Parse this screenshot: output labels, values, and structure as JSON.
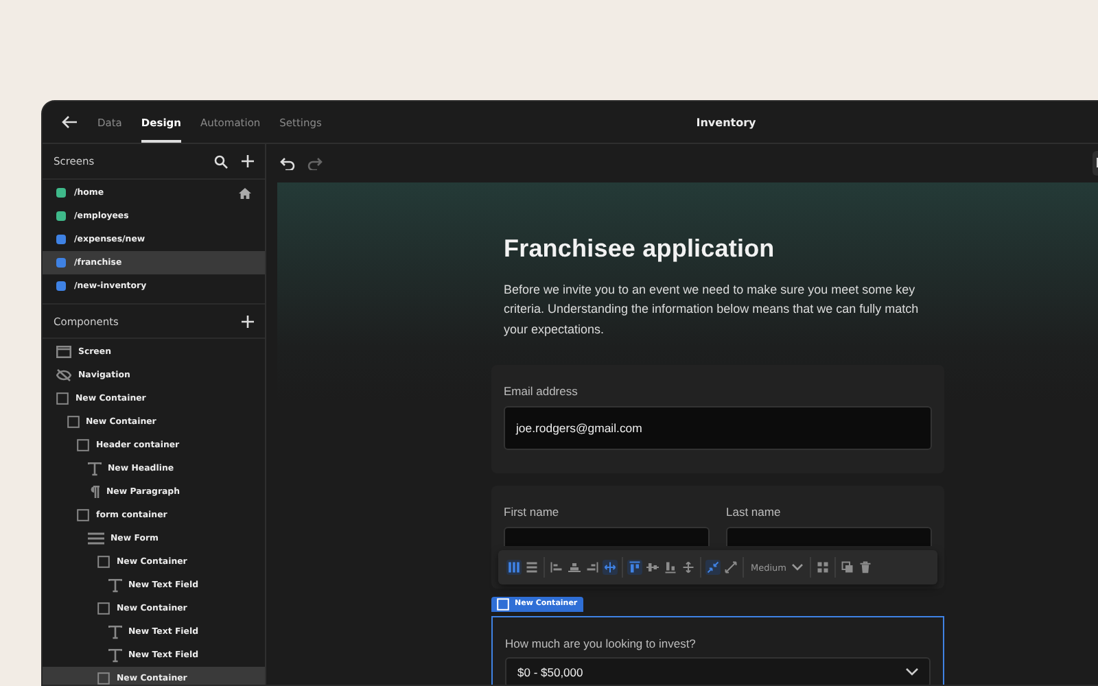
{
  "topbar": {
    "tabs": [
      {
        "label": "Data",
        "selected": false
      },
      {
        "label": "Design",
        "selected": true
      },
      {
        "label": "Automation",
        "selected": false
      },
      {
        "label": "Settings",
        "selected": false
      }
    ],
    "title": "Inventory"
  },
  "screens": {
    "title": "Screens",
    "items": [
      {
        "path": "/home",
        "color": "#3fb98a",
        "selected": false,
        "home": true
      },
      {
        "path": "/employees",
        "color": "#3fb98a",
        "selected": false,
        "home": false
      },
      {
        "path": "/expenses/new",
        "color": "#3f82e4",
        "selected": false,
        "home": false
      },
      {
        "path": "/franchise",
        "color": "#3f82e4",
        "selected": true,
        "home": false
      },
      {
        "path": "/new-inventory",
        "color": "#3f82e4",
        "selected": false,
        "home": false
      }
    ]
  },
  "components": {
    "title": "Components",
    "tree": [
      {
        "label": "Screen",
        "kind": "screen",
        "selected": false
      },
      {
        "label": "Navigation",
        "kind": "navigation",
        "selected": false
      },
      {
        "label": "New Container",
        "kind": "container",
        "selected": false,
        "children": [
          {
            "label": "New Container",
            "kind": "container",
            "selected": false,
            "children": [
              {
                "label": "Header container",
                "kind": "container",
                "selected": false,
                "children": [
                  {
                    "label": "New Headline",
                    "kind": "headline",
                    "selected": false
                  },
                  {
                    "label": "New Paragraph",
                    "kind": "paragraph",
                    "selected": false
                  }
                ]
              },
              {
                "label": "form container",
                "kind": "container",
                "selected": false,
                "children": [
                  {
                    "label": "New Form",
                    "kind": "form",
                    "selected": false,
                    "children": [
                      {
                        "label": "New Container",
                        "kind": "container",
                        "selected": false,
                        "children": [
                          {
                            "label": "New Text Field",
                            "kind": "textfield",
                            "selected": false
                          }
                        ]
                      },
                      {
                        "label": "New Container",
                        "kind": "container",
                        "selected": false,
                        "children": [
                          {
                            "label": "New Text Field",
                            "kind": "textfield",
                            "selected": false
                          },
                          {
                            "label": "New Text Field",
                            "kind": "textfield",
                            "selected": false
                          }
                        ]
                      },
                      {
                        "label": "New Container",
                        "kind": "container",
                        "selected": true
                      }
                    ]
                  }
                ]
              }
            ]
          }
        ]
      }
    ]
  },
  "canvas": {
    "headline": "Franchisee application",
    "paragraph": "Before we invite you to an event we need to make sure you meet some key criteria. Understanding the information below means that we can fully match your expectations.",
    "cards": [
      {
        "fields": [
          {
            "label": "Email address",
            "value": "joe.rodgers@gmail.com"
          }
        ]
      },
      {
        "fields": [
          {
            "label": "First name"
          },
          {
            "label": "Last name"
          }
        ]
      }
    ],
    "toolbar": {
      "size": "Medium",
      "groups": [
        [
          {
            "kind": "columns",
            "selected": true
          },
          {
            "kind": "rows",
            "selected": false
          }
        ],
        [
          {
            "kind": "align-left",
            "selected": false
          },
          {
            "kind": "align-center",
            "selected": false
          },
          {
            "kind": "align-right",
            "selected": false
          },
          {
            "kind": "stretch-h",
            "selected": true
          }
        ],
        [
          {
            "kind": "align-top",
            "selected": true
          },
          {
            "kind": "align-middle",
            "selected": false
          },
          {
            "kind": "align-bottom",
            "selected": false
          },
          {
            "kind": "stretch-v",
            "selected": false
          }
        ],
        [
          {
            "kind": "shrink",
            "selected": true
          },
          {
            "kind": "expand",
            "selected": false
          }
        ],
        [
          {
            "kind": "size"
          }
        ],
        [
          {
            "kind": "grid",
            "selected": false
          }
        ],
        [
          {
            "kind": "duplicate",
            "selected": false
          },
          {
            "kind": "delete",
            "selected": false
          }
        ]
      ]
    },
    "selected_container": {
      "tag": "New Container",
      "label": "How much are you looking to invest?",
      "value": "$0 - $50,000"
    }
  }
}
